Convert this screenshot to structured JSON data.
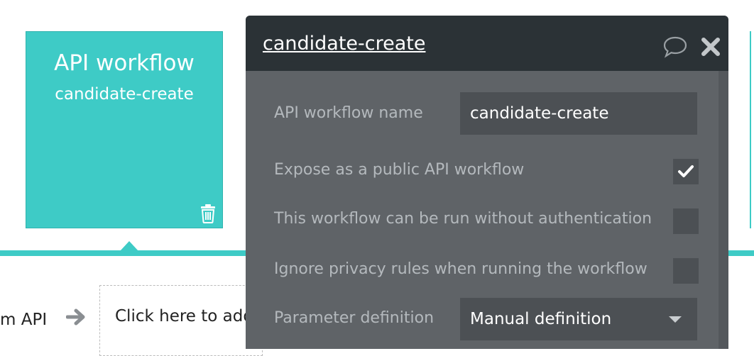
{
  "event_card": {
    "title": "API workflow",
    "subtitle": "candidate-create"
  },
  "canvas": {
    "previous_step_label": "m API",
    "add_step_label": "Click here to add"
  },
  "panel": {
    "title": "candidate-create",
    "fields": {
      "name_label": "API workflow name",
      "name_value": "candidate-create",
      "expose_label": "Expose as a public API workflow",
      "expose_checked": true,
      "no_auth_label": "This workflow can be run without authentication",
      "no_auth_checked": false,
      "ignore_privacy_label": "Ignore privacy rules when running the workflow",
      "ignore_privacy_checked": false,
      "param_def_label": "Parameter definition",
      "param_def_value": "Manual definition"
    }
  },
  "colors": {
    "accent": "#3ecbc6",
    "panel_bg": "#5f6367",
    "panel_header": "#2b3236"
  },
  "icons": [
    "trash-icon",
    "arrow-right-icon",
    "comment-icon",
    "close-icon",
    "checkmark-icon",
    "chevron-down-icon"
  ]
}
